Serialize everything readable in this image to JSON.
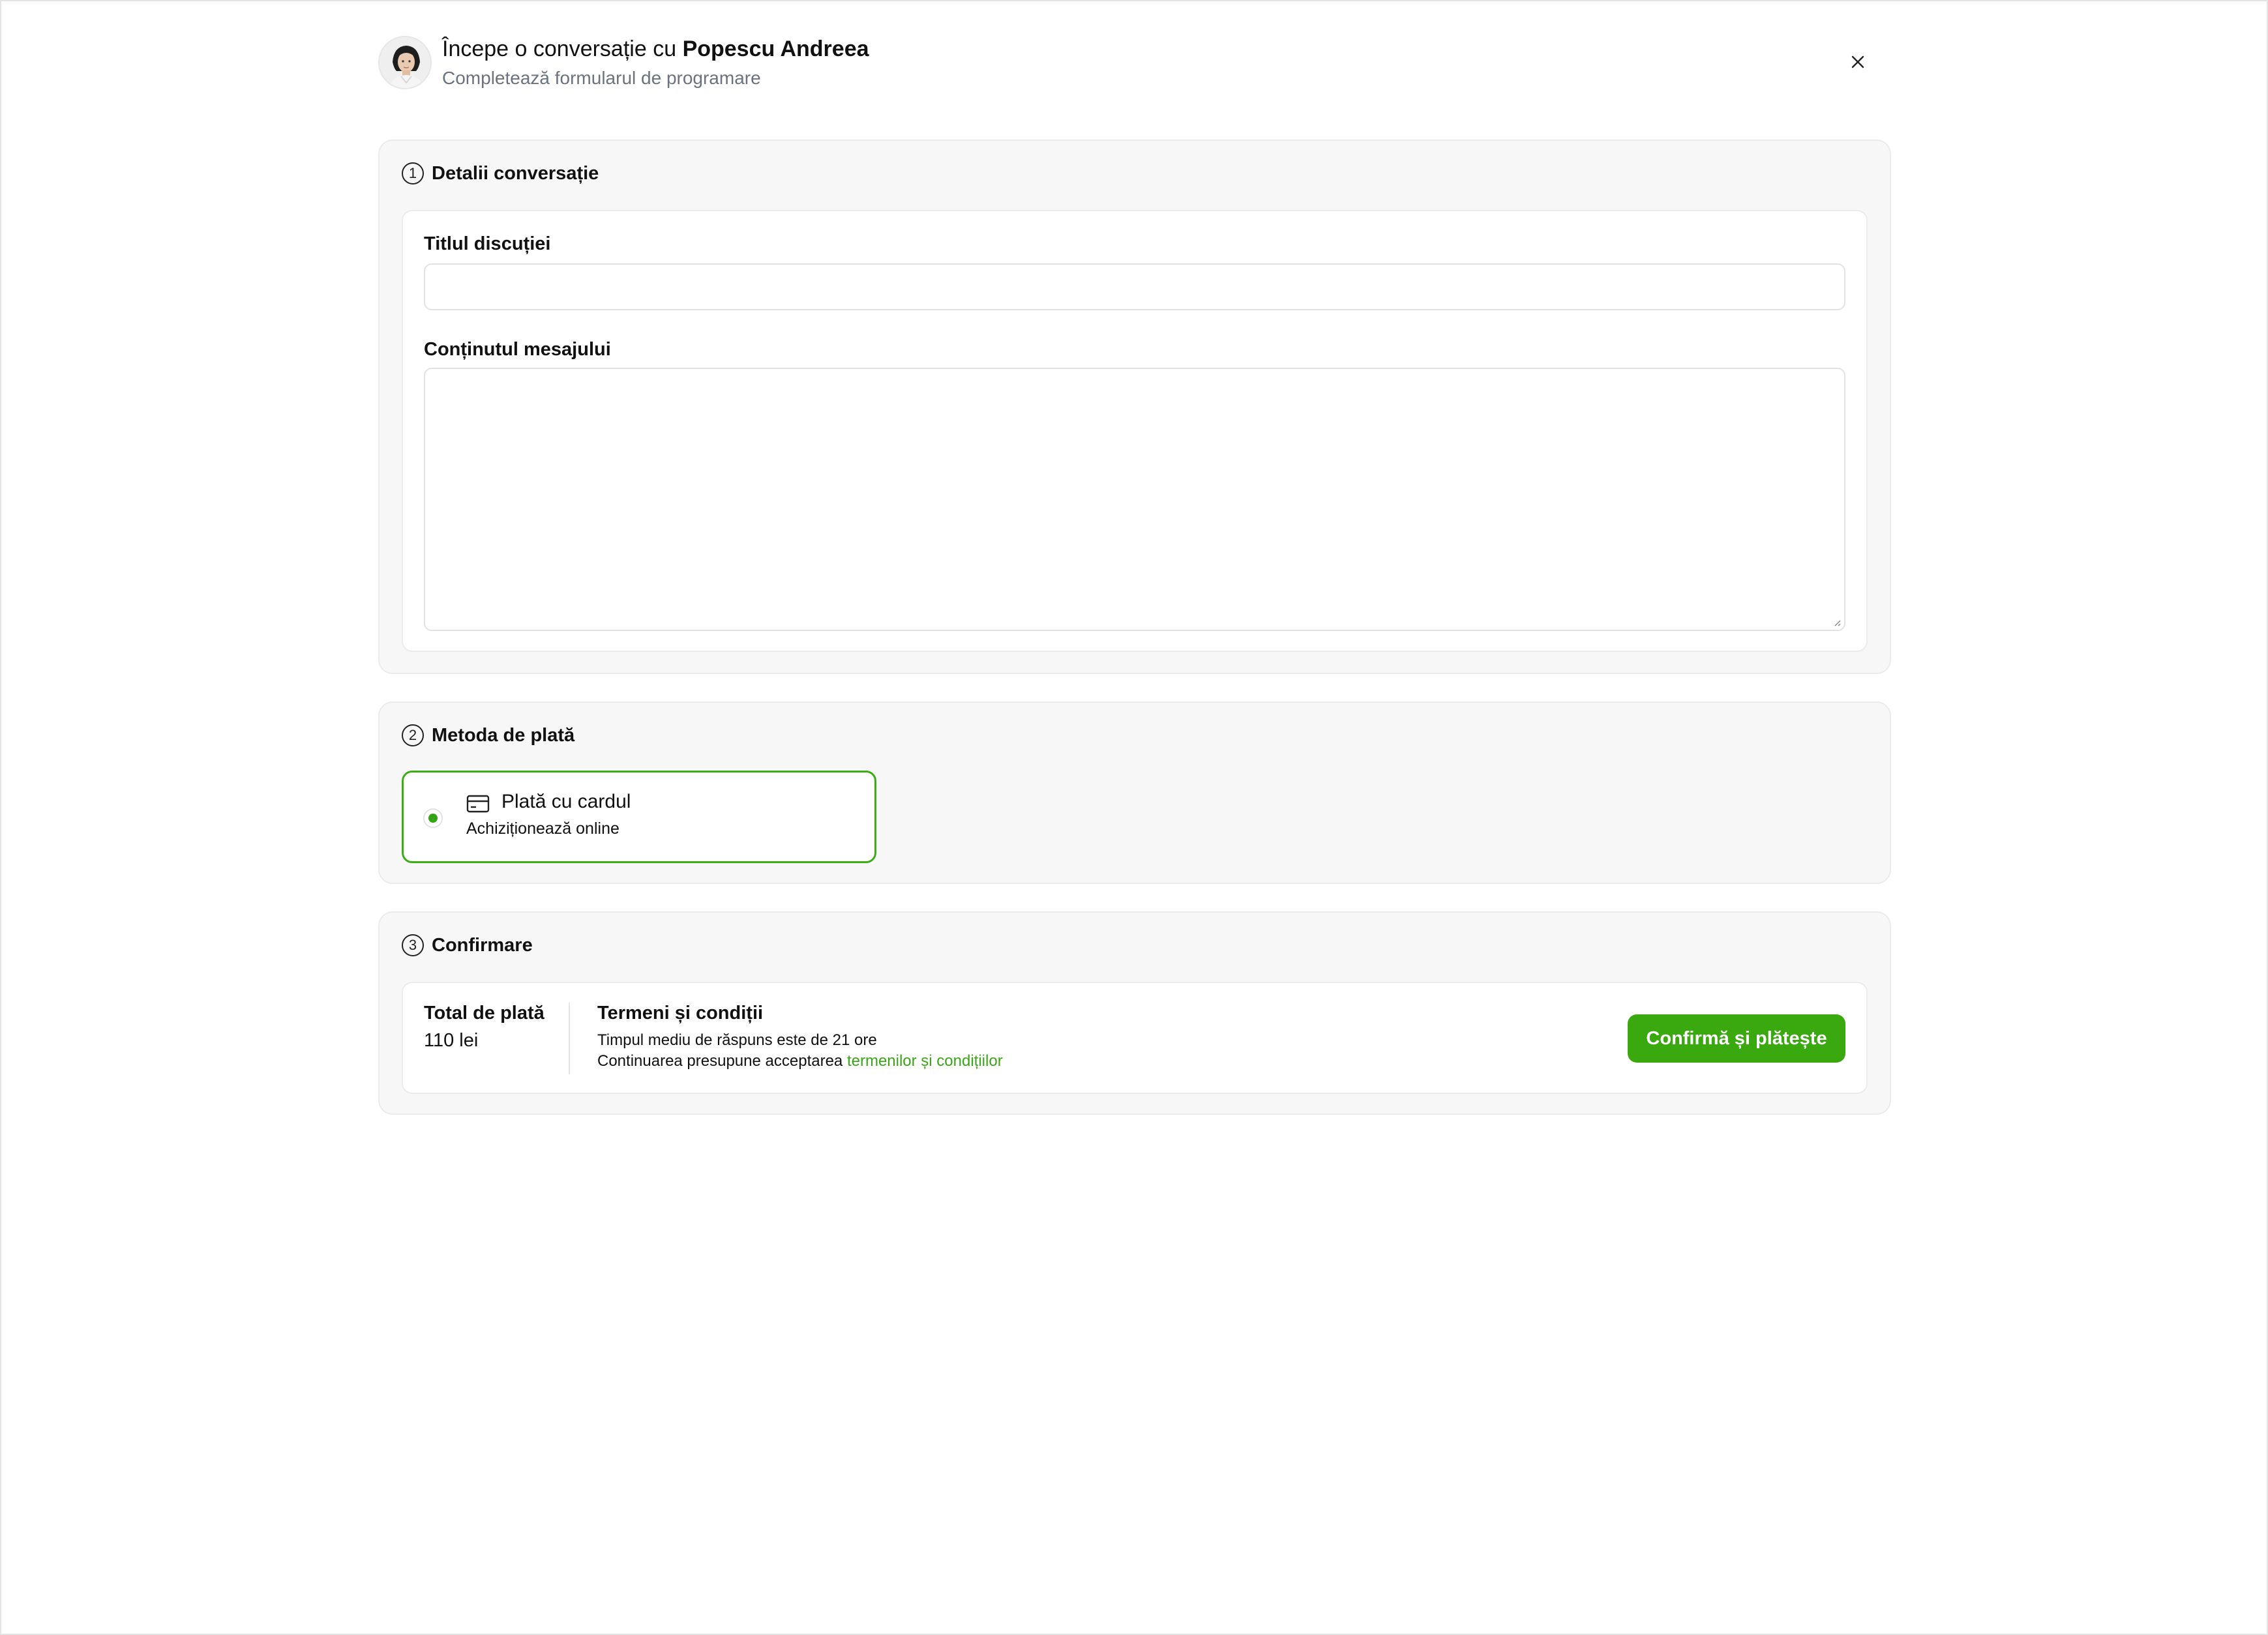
{
  "header": {
    "title_prefix": "Începe o conversație cu ",
    "title_name": "Popescu Andreea",
    "subtitle": "Completează formularul de programare"
  },
  "icons": {
    "close": "close-icon",
    "avatar": "avatar",
    "card": "credit-card-icon"
  },
  "colors": {
    "accent": "#3aa80f",
    "link": "#3aa516",
    "section_bg": "#f7f7f7"
  },
  "section1": {
    "number": "1",
    "title": "Detalii conversație",
    "title_field_label": "Titlul discuției",
    "title_field_value": "",
    "title_field_placeholder": "",
    "message_field_label": "Conținutul mesajului",
    "message_field_value": "",
    "message_field_placeholder": ""
  },
  "section2": {
    "number": "2",
    "title": "Metoda de plată",
    "option_title": "Plată cu cardul",
    "option_subtitle": "Achiziționează online"
  },
  "section3": {
    "number": "3",
    "title": "Confirmare",
    "total_label": "Total de plată",
    "total_value": "110 lei",
    "terms_title": "Termeni și condiții",
    "terms_line1": "Timpul mediu de răspuns este de 21 ore",
    "terms_line2_prefix": "Continuarea presupune acceptarea ",
    "terms_link": "termenilor și condițiilor",
    "confirm_button": "Confirmă și plătește"
  }
}
